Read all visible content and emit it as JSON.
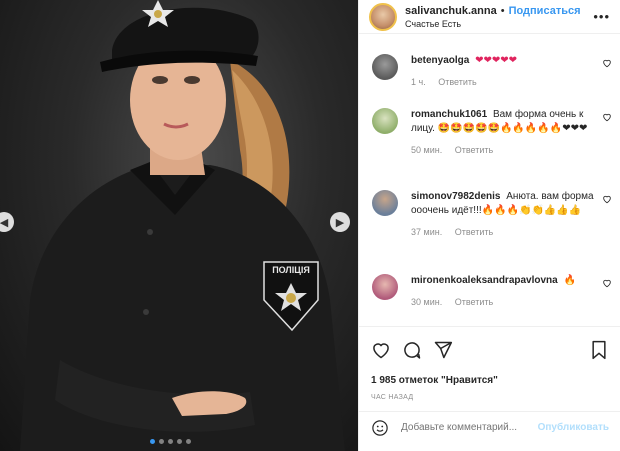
{
  "header": {
    "username": "salivanchuk.anna",
    "separator": "•",
    "follow_label": "Подписаться",
    "subtitle": "Счастье Есть",
    "more_icon": "more-horizontal-icon"
  },
  "photo": {
    "patch_text": "ПОЛІЦІЯ",
    "carousel_count": 5,
    "active_index": 0
  },
  "comments": [
    {
      "user": "betenyaolga",
      "text": "❤❤❤❤❤",
      "time": "1 ч.",
      "reply_label": "Ответить",
      "avatar_color": "#5a5a5a"
    },
    {
      "user": "romanchuk1061",
      "text": "Вам форма очень к лицу. 🤩🤩🤩🤩🤩🔥🔥🔥🔥🔥❤❤❤",
      "time": "50 мин.",
      "reply_label": "Ответить",
      "avatar_color": "#8fae6a"
    },
    {
      "user": "simonov7982denis",
      "text": "Анюта. вам форма ооочень идёт!!!🔥🔥🔥👏👏👍👍👍",
      "time": "37 мин.",
      "reply_label": "Ответить",
      "avatar_color": "#6b7f9a"
    },
    {
      "user": "mironenkoaleksandrapavlovna",
      "text": "🔥",
      "time": "30 мин.",
      "reply_label": "Ответить",
      "avatar_color": "#b05a7a"
    }
  ],
  "actions": {
    "likes_text": "1 985 отметок \"Нравится\"",
    "time_ago": "ЧАС НАЗАД",
    "add_comment_placeholder": "Добавьте комментарий...",
    "publish_label": "Опубликовать"
  },
  "colors": {
    "accent": "#3897f0",
    "muted": "#8e8e8e",
    "publish_disabled": "#b2dffc"
  }
}
